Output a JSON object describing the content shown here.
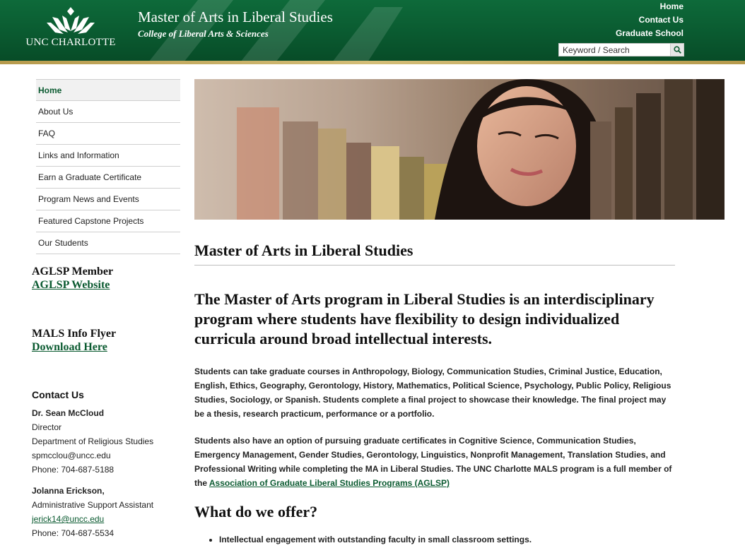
{
  "header": {
    "logo_text": "UNC CHARLOTTE",
    "title": "Master of Arts in Liberal Studies",
    "subtitle": "College of Liberal Arts & Sciences",
    "utility_links": [
      "Home",
      "Contact Us",
      "Graduate School"
    ],
    "search_placeholder": "Keyword / Search",
    "search_icon": "magnifier-icon"
  },
  "nav": {
    "items": [
      {
        "label": "Home",
        "active": true
      },
      {
        "label": "About Us"
      },
      {
        "label": "FAQ"
      },
      {
        "label": "Links and Information"
      },
      {
        "label": "Earn a Graduate Certificate"
      },
      {
        "label": "Program News and Events"
      },
      {
        "label": "Featured Capstone Projects"
      },
      {
        "label": "Our Students"
      }
    ]
  },
  "sidebar": {
    "aglsp_heading": "AGLSP Member",
    "aglsp_link": "AGLSP Website",
    "flyer_heading": "MALS Info Flyer",
    "flyer_link": "Download Here",
    "contact": {
      "heading": "Contact Us",
      "person1_name": "Dr. Sean McCloud",
      "person1_title": "Director",
      "person1_dept": "Department of Religious Studies",
      "person1_email": "spmcclou@uncc.edu",
      "person1_phone": "Phone: 704-687-5188",
      "person2_name": "Jolanna Erickson,",
      "person2_title": "Administrative Support Assistant",
      "person2_email": "jerick14@uncc.edu",
      "person2_phone": "Phone: 704-687-5534"
    }
  },
  "main": {
    "page_title": "Master of Arts in Liberal Studies",
    "lead": "The Master of Arts program in Liberal Studies is an interdisciplinary program where students have flexibility to design individualized curricula around broad intellectual interests.",
    "para1": "Students can take graduate courses in Anthropology, Biology, Communication Studies, Criminal Justice, Education, English, Ethics, Geography, Gerontology, History, Mathematics, Political Science, Psychology, Public Policy, Religious Studies, Sociology, or Spanish.  Students complete a final project to showcase their knowledge. The final project may be a thesis, research practicum, performance or a portfolio.",
    "para2_text": "Students also have an option of pursuing graduate certificates in Cognitive Science, Communication Studies, Emergency Management, Gender Studies, Gerontology, Linguistics, Nonprofit Management, Translation Studies, and Professional Writing while completing the MA in Liberal Studies.  The UNC Charlotte MALS program is a full member of the ",
    "para2_link": "Association of Graduate Liberal Studies Programs (AGLSP)",
    "offer_heading": "What do we offer?",
    "offer_items": [
      "Intellectual engagement with outstanding faculty in small classroom settings."
    ]
  },
  "colors": {
    "brand_green": "#0a5a30",
    "gold": "#c9b26a"
  }
}
